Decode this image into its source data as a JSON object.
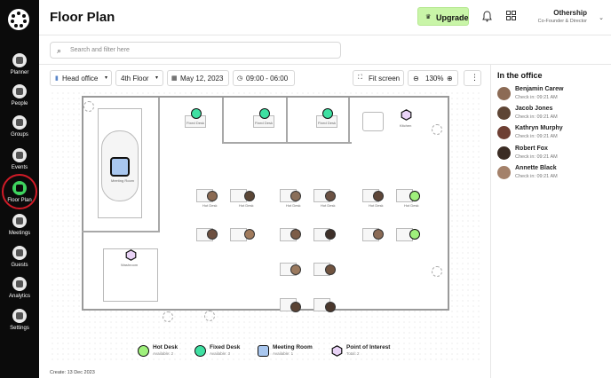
{
  "sidebar": {
    "items": [
      {
        "label": "Planner",
        "icon": "planner-icon"
      },
      {
        "label": "People",
        "icon": "people-icon"
      },
      {
        "label": "Groups",
        "icon": "groups-icon"
      },
      {
        "label": "Events",
        "icon": "events-icon"
      },
      {
        "label": "Floor Plan",
        "icon": "floor-plan-icon",
        "active": true
      },
      {
        "label": "Meetings",
        "icon": "meetings-icon"
      },
      {
        "label": "Guests",
        "icon": "guests-icon"
      },
      {
        "label": "Analytics",
        "icon": "analytics-icon"
      },
      {
        "label": "Settings",
        "icon": "settings-icon"
      }
    ]
  },
  "header": {
    "title": "Floor Plan",
    "upgrade_label": "Upgrade",
    "user_name": "Othership",
    "user_role": "Co-Founder & Director"
  },
  "search": {
    "placeholder": "Search and filter here"
  },
  "controls": {
    "office": "Head office",
    "floor": "4th Floor",
    "date": "May 12, 2023",
    "time": "09:00 - 06:00",
    "fit_screen": "Fit screen",
    "zoom": "130%"
  },
  "floorplan": {
    "fixed_desk_label": "Fixed Desk",
    "hot_desk_label": "Hot Desk",
    "meeting_room_label": "Meeting Room",
    "kitchen_label": "Kitchen",
    "washroom_label": "Washroom"
  },
  "legend": [
    {
      "title": "Hot Desk",
      "sub": "Available: 2",
      "color": "#9ff07c",
      "shape": "circle"
    },
    {
      "title": "Fixed Desk",
      "sub": "Available: 3",
      "color": "#3fe0a2",
      "shape": "circle"
    },
    {
      "title": "Meeting Room",
      "sub": "Available: 1",
      "color": "#a9c7ef",
      "shape": "square"
    },
    {
      "title": "Point of Interest",
      "sub": "Total: 2",
      "color": "#e9d3f6",
      "shape": "hexagon"
    }
  ],
  "footer": {
    "created": "Create: 13 Dec 2023"
  },
  "office_panel": {
    "title": "In the office",
    "people": [
      {
        "name": "Benjamin Carew",
        "check": "Check in: 09:21 AM"
      },
      {
        "name": "Jacob Jones",
        "check": "Check in: 09:21 AM"
      },
      {
        "name": "Kathryn Murphy",
        "check": "Check in: 09:21 AM"
      },
      {
        "name": "Robert Fox",
        "check": "Check in: 09:21 AM"
      },
      {
        "name": "Annette Black",
        "check": "Check in: 09:21 AM"
      }
    ]
  },
  "colors": {
    "accent_green": "#3fd45f",
    "upgrade_bg": "#c9f5a8",
    "highlight_ring": "#d11b27"
  }
}
